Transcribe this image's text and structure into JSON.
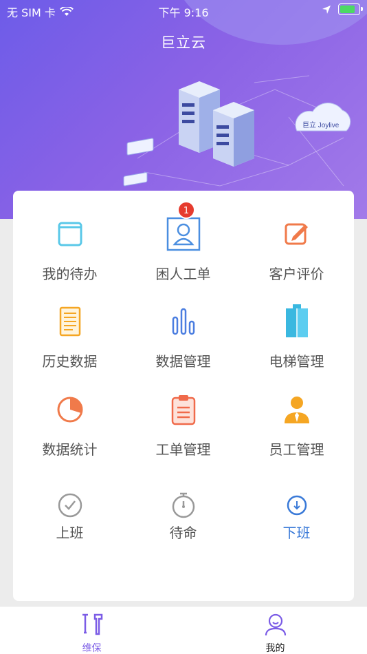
{
  "status_bar": {
    "carrier": "无 SIM 卡",
    "time": "下午 9:16"
  },
  "header": {
    "title": "巨立云"
  },
  "hero": {
    "cloud_logo_text": "巨立 Joylive"
  },
  "grid": [
    {
      "label": "我的待办",
      "icon": "inbox-icon",
      "color": "#5ac8e8"
    },
    {
      "label": "困人工单",
      "icon": "person-card-icon",
      "color": "#4a8ee0",
      "badge": "1"
    },
    {
      "label": "客户评价",
      "icon": "edit-icon",
      "color": "#f07a4a"
    },
    {
      "label": "历史数据",
      "icon": "document-icon",
      "color": "#f5a623"
    },
    {
      "label": "数据管理",
      "icon": "bar-chart-icon",
      "color": "#4a7de0"
    },
    {
      "label": "电梯管理",
      "icon": "elevator-icon",
      "color": "#3ab8e0"
    },
    {
      "label": "数据统计",
      "icon": "pie-chart-icon",
      "color": "#f07a4a"
    },
    {
      "label": "工单管理",
      "icon": "clipboard-icon",
      "color": "#f06a4a"
    },
    {
      "label": "员工管理",
      "icon": "employee-icon",
      "color": "#f5a623"
    }
  ],
  "shift_actions": [
    {
      "label": "上班",
      "icon": "check-circle-icon"
    },
    {
      "label": "待命",
      "icon": "stopwatch-icon"
    },
    {
      "label": "下班",
      "icon": "download-circle-icon",
      "active": true
    }
  ],
  "tabbar": {
    "tabs": [
      {
        "label": "维保",
        "icon": "tools-icon",
        "active": true
      },
      {
        "label": "我的",
        "icon": "user-icon",
        "active": false
      }
    ]
  },
  "colors": {
    "accent": "#6d5ce8",
    "active_tab": "#7b5ce6",
    "shift_active": "#3a7ad8",
    "badge": "#e63b2e"
  }
}
